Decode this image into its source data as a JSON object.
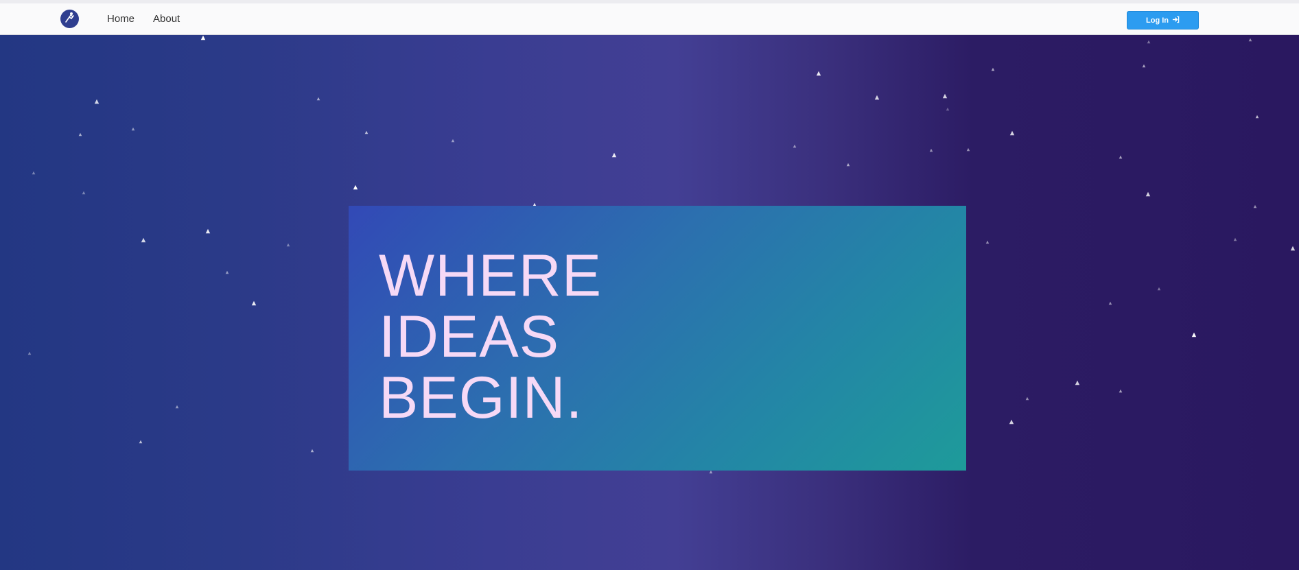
{
  "nav": {
    "home_label": "Home",
    "about_label": "About",
    "login_label": "Log In",
    "logo_icon": "mountain-climber-icon",
    "login_icon": "sign-in-icon"
  },
  "hero": {
    "headline_lines": [
      "WHERE",
      "IDEAS",
      "BEGIN."
    ]
  },
  "colors": {
    "navbar_bg": "#fafafb",
    "login_button": "#2c9cf0",
    "hero_left": "#233783",
    "hero_mid": "#433f94",
    "hero_right": "#2a1860",
    "panel_start": "#3249b6",
    "panel_end": "#1e9b9a",
    "headline_text": "#f6d9f6"
  }
}
